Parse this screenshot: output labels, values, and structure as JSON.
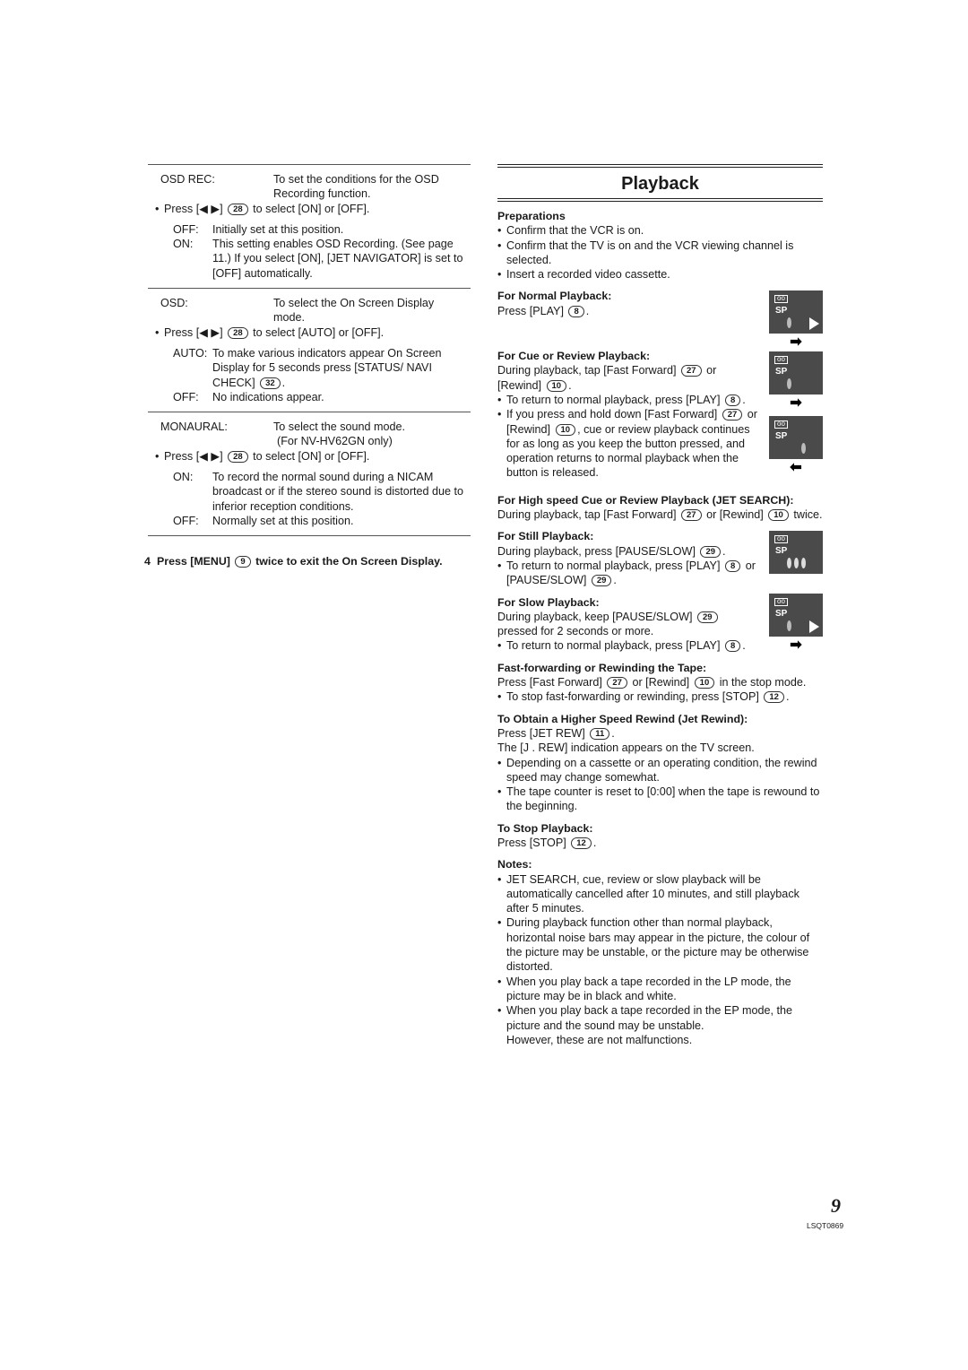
{
  "left": {
    "entries": [
      {
        "key": "OSD REC:",
        "desc": [
          "To set the conditions for the OSD",
          "Recording function."
        ],
        "press": {
          "pre": "Press [",
          "arrows": "◀ ▶",
          "post_bracket": "]",
          "badge": "28",
          "post": "to select [ON] or [OFF]."
        },
        "options": [
          {
            "k": "OFF:",
            "v": "Initially set at this position."
          },
          {
            "k": "ON:",
            "v": "This setting enables OSD Recording. (See page 11.) If you select [ON], [JET NAVIGATOR] is set to [OFF] automatically."
          }
        ]
      },
      {
        "key": "OSD:",
        "desc": [
          "To select the On Screen Display",
          "mode."
        ],
        "press": {
          "pre": "Press [",
          "arrows": "◀ ▶",
          "post_bracket": "]",
          "badge": "28",
          "post": "to select [AUTO] or [OFF]."
        },
        "options": [
          {
            "k": "AUTO:",
            "v": "To make various indicators appear On Screen Display for 5 seconds press [STATUS/ NAVI CHECK]",
            "badge": "32",
            "tail": "."
          },
          {
            "k": "OFF:",
            "v": "No indications appear."
          }
        ]
      },
      {
        "key": "MONAURAL:",
        "desc": [
          "To select the sound mode.",
          "(For NV-HV62GN only)"
        ],
        "press": {
          "pre": "Press [",
          "arrows": "◀ ▶",
          "post_bracket": "]",
          "badge": "28",
          "post": "to select [ON] or [OFF]."
        },
        "options": [
          {
            "k": "ON:",
            "v": "To record the normal sound during a NICAM broadcast or if the stereo sound is distorted due to inferior reception conditions."
          },
          {
            "k": "OFF:",
            "v": "Normally set at this position."
          }
        ]
      }
    ],
    "step": {
      "num": "4",
      "pre": "Press [MENU]",
      "badge": "9",
      "post": "twice to exit the On Screen Display."
    }
  },
  "right": {
    "title": "Playback",
    "preparations": {
      "heading": "Preparations",
      "bullets": [
        "Confirm that the VCR is on.",
        "Confirm that the TV is on and the VCR viewing channel is selected.",
        "Insert a recorded video cassette."
      ]
    },
    "normal": {
      "heading": "For Normal Playback:",
      "pre": "Press [PLAY]",
      "badge": "8",
      "post": "."
    },
    "cue": {
      "heading": "For Cue or Review Playback:",
      "line1_pre": "During playback, tap [Fast Forward]",
      "line1_badge": "27",
      "line1_mid": "or [Rewind]",
      "line1_badge2": "10",
      "line1_post": ".",
      "b1_pre": "To return to normal playback, press [PLAY]",
      "b1_badge": "8",
      "b1_post": ".",
      "b2_pre": "If you press and hold down [Fast Forward]",
      "b2_badge": "27",
      "b2_mid": "or [Rewind]",
      "b2_badge2": "10",
      "b2_post": ", cue or review playback continues for as long as you keep the button pressed, and operation returns to normal playback when the button is released."
    },
    "jet": {
      "heading": "For High speed Cue or Review Playback (JET SEARCH):",
      "pre": "During playback, tap [Fast Forward]",
      "badge": "27",
      "mid": "or [Rewind]",
      "badge2": "10",
      "post": "twice."
    },
    "still": {
      "heading": "For Still Playback:",
      "pre": "During playback, press [PAUSE/SLOW]",
      "badge": "29",
      "post": ".",
      "b_pre": "To return to normal playback, press [PLAY]",
      "b_badge": "8",
      "b_mid": "or [PAUSE/SLOW]",
      "b_badge2": "29",
      "b_post": "."
    },
    "slow": {
      "heading": "For Slow Playback:",
      "pre": "During playback, keep [PAUSE/SLOW]",
      "badge": "29",
      "post": "pressed for 2 seconds or more.",
      "b_pre": "To return to normal playback, press [PLAY]",
      "b_badge": "8",
      "b_post": "."
    },
    "ff": {
      "heading": "Fast-forwarding or Rewinding the Tape:",
      "pre": "Press [Fast Forward]",
      "badge": "27",
      "mid": "or [Rewind]",
      "badge2": "10",
      "post": "in the stop mode.",
      "b_pre": "To stop fast-forwarding or rewinding, press [STOP]",
      "b_badge": "12",
      "b_post": "."
    },
    "jetrew": {
      "heading": "To Obtain a Higher Speed Rewind (Jet Rewind):",
      "pre": "Press [JET REW]",
      "badge": "11",
      "post": ".",
      "line2": "The [J . REW] indication appears on the TV screen.",
      "bullets": [
        "Depending on a cassette or an operating condition, the rewind speed may change somewhat.",
        "The tape counter is reset to [0:00] when the tape is rewound to the beginning."
      ]
    },
    "stop": {
      "heading": "To Stop Playback:",
      "pre": "Press [STOP]",
      "badge": "12",
      "post": "."
    },
    "notes": {
      "heading": "Notes:",
      "bullets": [
        "JET SEARCH, cue, review or slow playback will be automatically cancelled after 10 minutes, and still playback after 5 minutes.",
        "During playback function other than normal playback, horizontal noise bars may appear in the picture, the colour of the picture may be unstable, or the picture may be otherwise distorted.",
        "When you play back a tape recorded in the LP mode, the picture may be in black and white.",
        "When you play back a tape recorded in the EP mode, the picture and the sound may be unstable."
      ],
      "trailer": "However, these are not malfunctions."
    },
    "osd_label": "SP",
    "tape_icon": "oo"
  },
  "footer": {
    "page": "9",
    "code": "LSQT0869"
  }
}
